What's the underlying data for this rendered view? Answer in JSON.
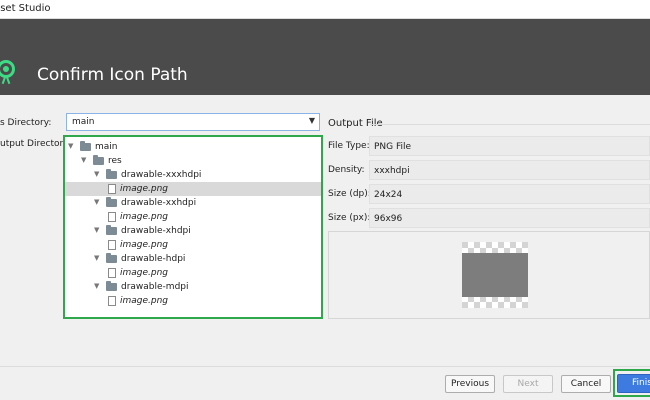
{
  "window": {
    "title": "sset Studio"
  },
  "banner": {
    "title": "Confirm Icon Path"
  },
  "form": {
    "res_directory_label": "s Directory:",
    "res_directory_value": "main",
    "output_dirs_label": "utput Directories:"
  },
  "tree": [
    {
      "label": "main",
      "type": "folder",
      "level": 0,
      "italic": false,
      "selected": false
    },
    {
      "label": "res",
      "type": "folder",
      "level": 1,
      "italic": false,
      "selected": false
    },
    {
      "label": "drawable-xxxhdpi",
      "type": "folder",
      "level": 2,
      "italic": false,
      "selected": false
    },
    {
      "label": "image.png",
      "type": "file",
      "level": 3,
      "italic": true,
      "selected": true
    },
    {
      "label": "drawable-xxhdpi",
      "type": "folder",
      "level": 2,
      "italic": false,
      "selected": false
    },
    {
      "label": "image.png",
      "type": "file",
      "level": 3,
      "italic": true,
      "selected": false
    },
    {
      "label": "drawable-xhdpi",
      "type": "folder",
      "level": 2,
      "italic": false,
      "selected": false
    },
    {
      "label": "image.png",
      "type": "file",
      "level": 3,
      "italic": true,
      "selected": false
    },
    {
      "label": "drawable-hdpi",
      "type": "folder",
      "level": 2,
      "italic": false,
      "selected": false
    },
    {
      "label": "image.png",
      "type": "file",
      "level": 3,
      "italic": true,
      "selected": false
    },
    {
      "label": "drawable-mdpi",
      "type": "folder",
      "level": 2,
      "italic": false,
      "selected": false
    },
    {
      "label": "image.png",
      "type": "file",
      "level": 3,
      "italic": true,
      "selected": false
    }
  ],
  "output_file": {
    "heading": "Output File",
    "file_type_label": "File Type:",
    "file_type_value": "PNG File",
    "density_label": "Density:",
    "density_value": "xxxhdpi",
    "size_dp_label": "Size (dp):",
    "size_dp_value": "24x24",
    "size_px_label": "Size (px):",
    "size_px_value": "96x96"
  },
  "buttons": {
    "previous": "Previous",
    "next": "Next",
    "cancel": "Cancel",
    "finish": "Finish"
  },
  "colors": {
    "highlight_border": "#2ea84a",
    "banner": "#4b4b4b",
    "finish_button": "#3d7be0",
    "selection": "#d9d9d9"
  }
}
